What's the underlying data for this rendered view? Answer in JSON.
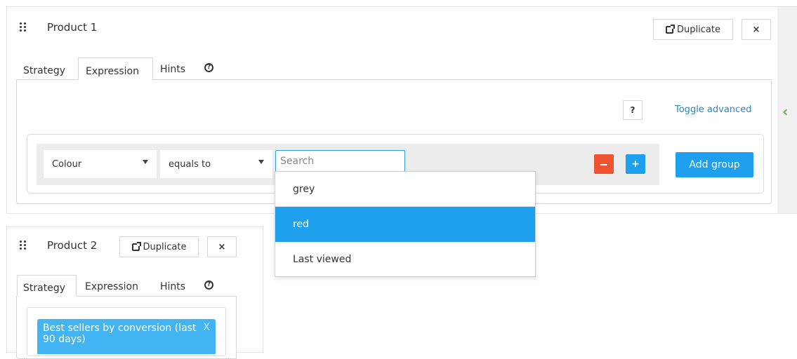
{
  "product1": {
    "title": "Product 1",
    "duplicate_label": "Duplicate",
    "close_label": "×",
    "tabs": [
      {
        "label": "Strategy",
        "active": false
      },
      {
        "label": "Expression",
        "active": true
      },
      {
        "label": "Hints",
        "active": false
      }
    ],
    "help_label": "?",
    "toggle_advanced_label": "Toggle advanced",
    "rule": {
      "field": "Colour",
      "operator": "equals to",
      "search_placeholder": "Search"
    },
    "remove_label": "−",
    "add_label": "+",
    "add_group_label": "Add group",
    "dropdown": [
      {
        "label": "grey",
        "selected": false
      },
      {
        "label": "red",
        "selected": true
      },
      {
        "label": "Last viewed",
        "selected": false
      }
    ]
  },
  "product2": {
    "title": "Product 2",
    "duplicate_label": "Duplicate",
    "close_label": "×",
    "tabs": [
      {
        "label": "Strategy",
        "active": true
      },
      {
        "label": "Expression",
        "active": false
      },
      {
        "label": "Hints",
        "active": false
      }
    ],
    "strategy_item": "Best sellers by conversion (last 90 days)",
    "strategy_item_close": "X"
  },
  "colors": {
    "primary": "#1ea0ee",
    "danger": "#ee5432",
    "link": "#2a86c8",
    "strategy_chip": "#43b4f2",
    "collapse_chevron": "#6aa84f"
  },
  "icons": {
    "drag_handle": "grip-dots-icon",
    "duplicate": "duplicate-icon",
    "help": "question-circle-icon",
    "collapse": "chevron-left-icon",
    "dropdown_caret": "caret-down-icon"
  }
}
